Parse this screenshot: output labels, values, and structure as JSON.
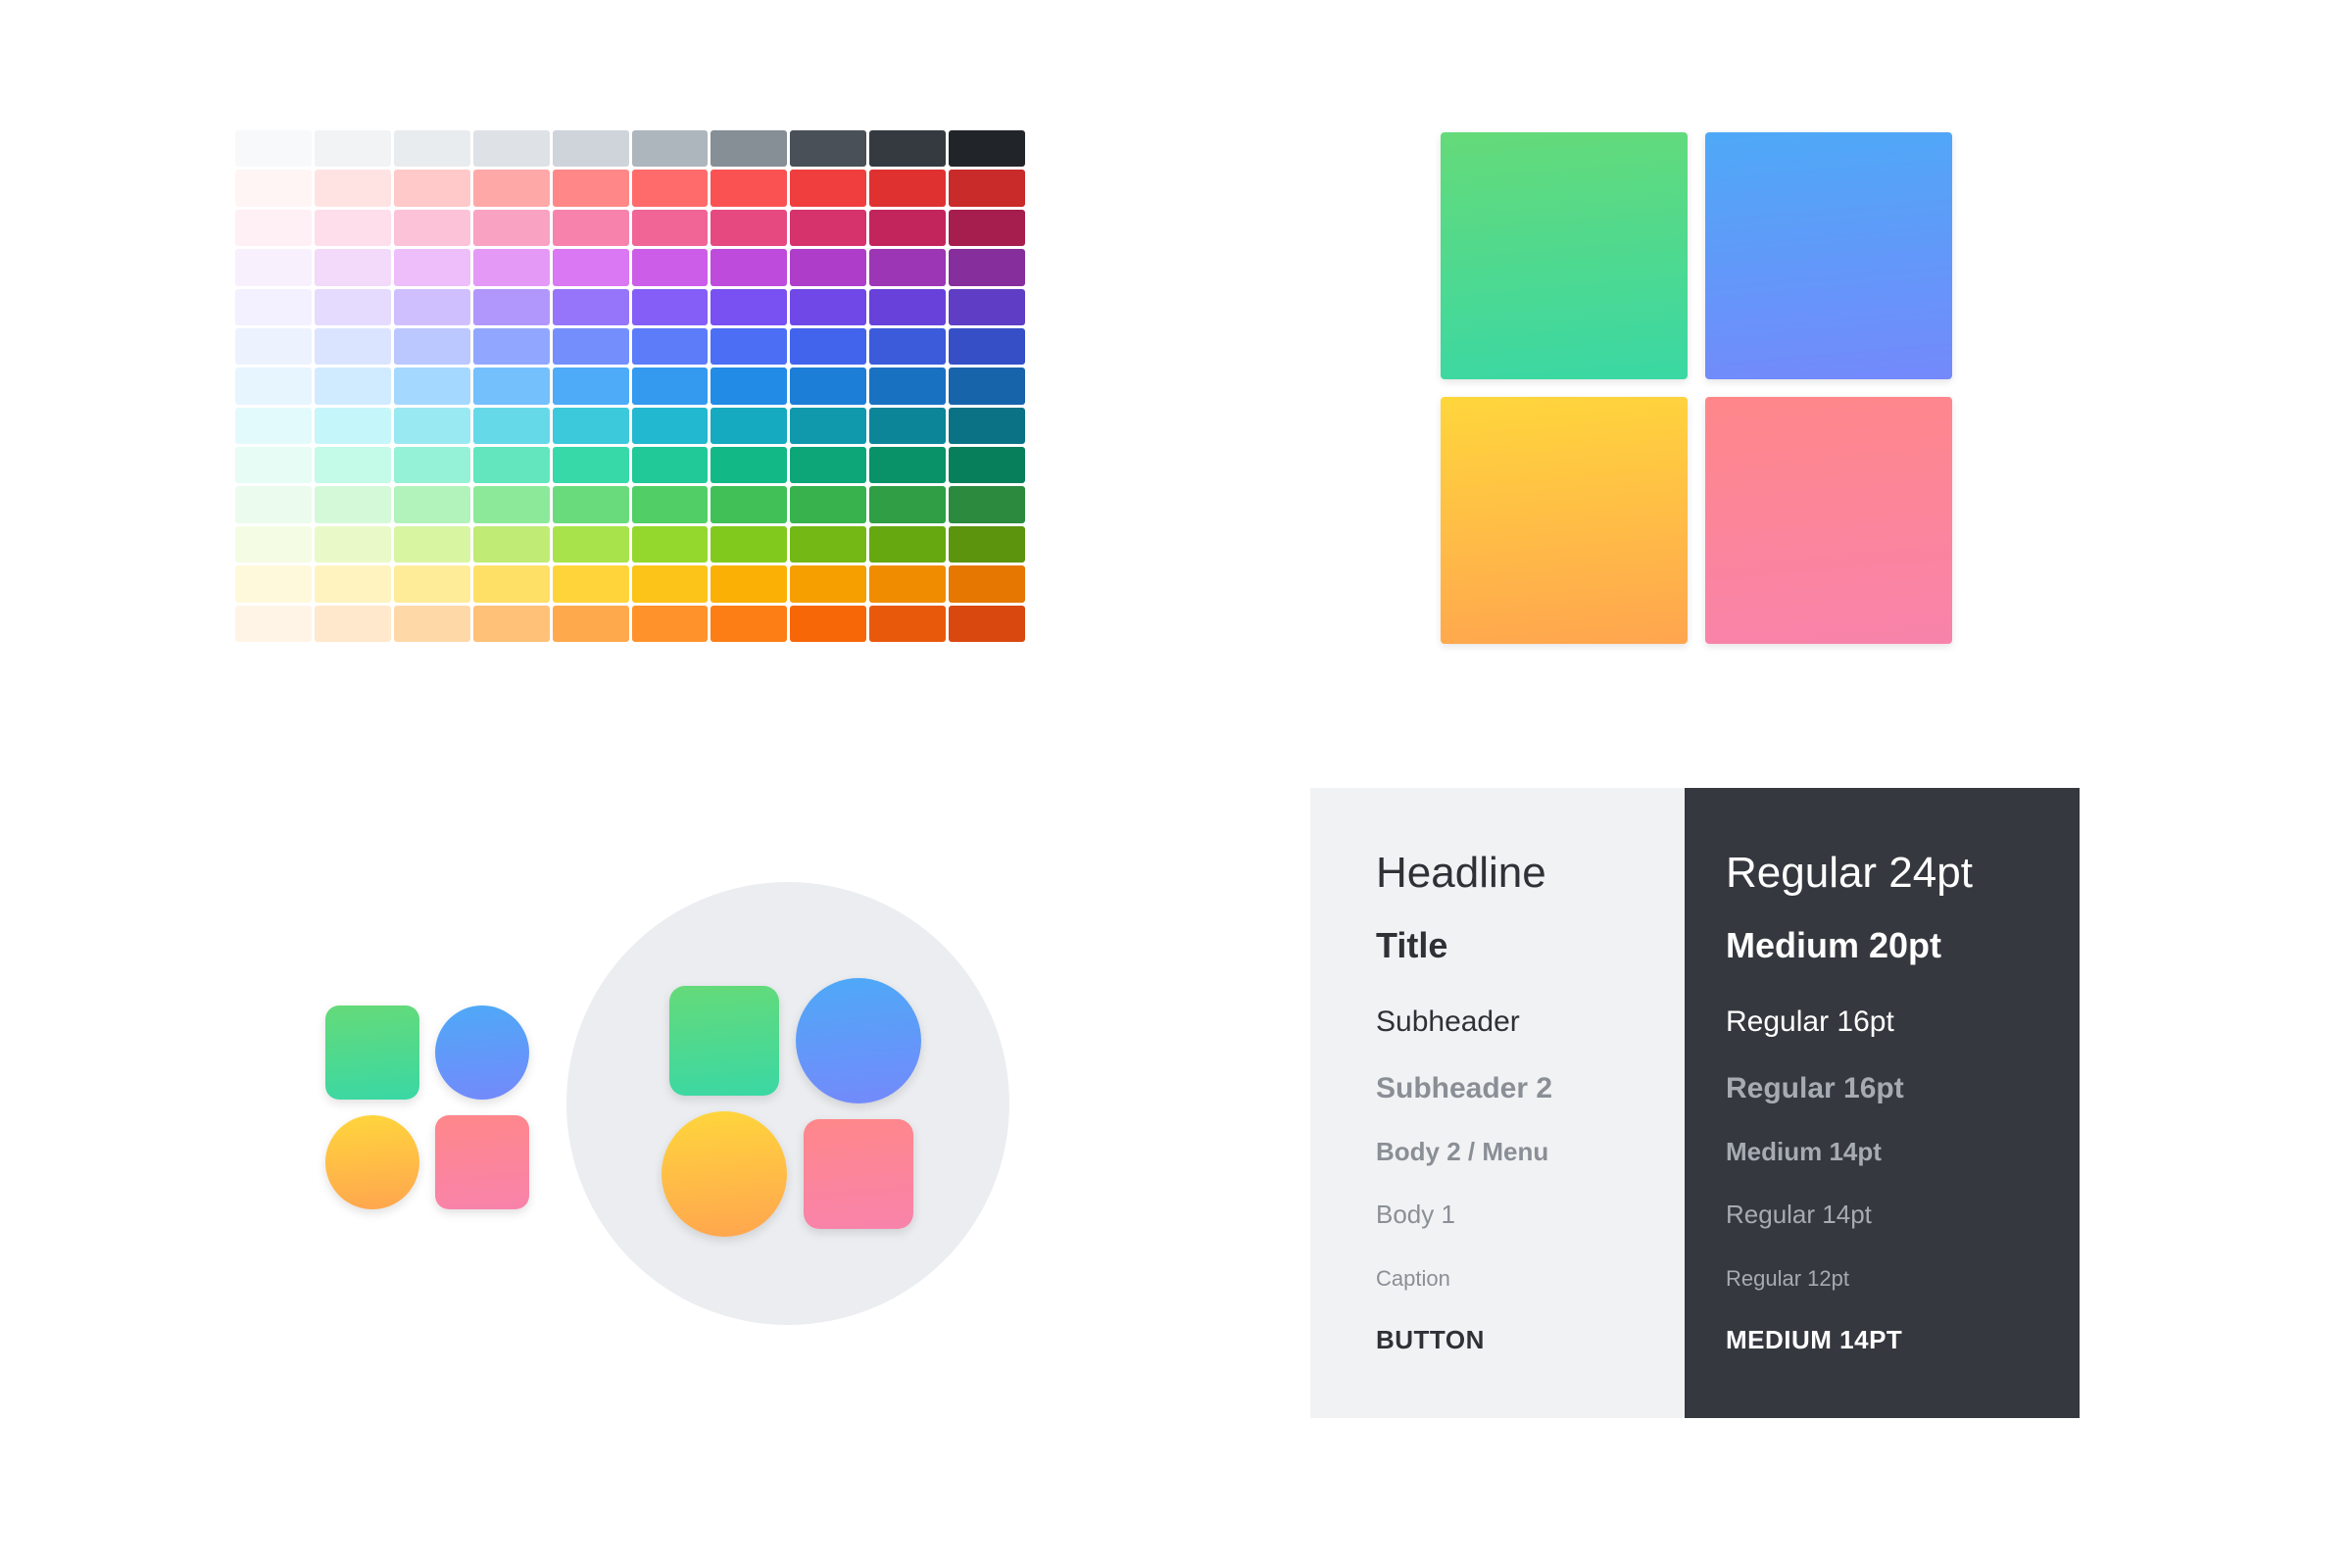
{
  "palette": {
    "rows": [
      [
        "#f8f9fa",
        "#f1f3f5",
        "#e9ecef",
        "#dee2e6",
        "#ced4da",
        "#adb5bd",
        "#868e96",
        "#495057",
        "#343a40",
        "#212529"
      ],
      [
        "#fff5f5",
        "#ffe3e3",
        "#ffc9c9",
        "#ffa8a8",
        "#ff8787",
        "#ff6b6b",
        "#fa5252",
        "#f03e3e",
        "#e03131",
        "#c92a2a"
      ],
      [
        "#fff0f6",
        "#ffdeeb",
        "#fcc2d7",
        "#faa2c1",
        "#f783ac",
        "#f06595",
        "#e64980",
        "#d6336c",
        "#c2255c",
        "#a61e4d"
      ],
      [
        "#f8f0fc",
        "#f3d9fa",
        "#eebefa",
        "#e599f7",
        "#da77f2",
        "#cc5de8",
        "#be4bdb",
        "#ae3ec9",
        "#9c36b5",
        "#862e9c"
      ],
      [
        "#f3f0ff",
        "#e5dbff",
        "#d0bfff",
        "#b197fc",
        "#9775fa",
        "#845ef7",
        "#7950f2",
        "#7048e8",
        "#6741d9",
        "#5f3dc4"
      ],
      [
        "#edf2ff",
        "#dbe4ff",
        "#bac8ff",
        "#91a7ff",
        "#748ffc",
        "#5c7cfa",
        "#4c6ef5",
        "#4263eb",
        "#3b5bdb",
        "#364fc7"
      ],
      [
        "#e7f5ff",
        "#d0ebff",
        "#a5d8ff",
        "#74c0fc",
        "#4dabf7",
        "#339af0",
        "#228be6",
        "#1c7ed6",
        "#1971c2",
        "#1864ab"
      ],
      [
        "#e3fafc",
        "#c5f6fa",
        "#99e9f2",
        "#66d9e8",
        "#3bc9db",
        "#22b8cf",
        "#15aabf",
        "#1098ad",
        "#0c8599",
        "#0b7285"
      ],
      [
        "#e6fcf5",
        "#c3fae8",
        "#96f2d7",
        "#63e6be",
        "#38d9a9",
        "#20c997",
        "#12b886",
        "#0ca678",
        "#099268",
        "#087f5b"
      ],
      [
        "#ebfbee",
        "#d3f9d8",
        "#b2f2bb",
        "#8ce99a",
        "#69db7c",
        "#51cf66",
        "#40c057",
        "#37b24d",
        "#2f9e44",
        "#2b8a3e"
      ],
      [
        "#f4fce3",
        "#e9fac8",
        "#d8f5a2",
        "#c0eb75",
        "#a9e34b",
        "#94d82d",
        "#82c91e",
        "#74b816",
        "#66a80f",
        "#5c940d"
      ],
      [
        "#fff9db",
        "#fff3bf",
        "#ffec99",
        "#ffe066",
        "#ffd43b",
        "#fcc419",
        "#fab005",
        "#f59f00",
        "#f08c00",
        "#e67700"
      ],
      [
        "#fff4e6",
        "#ffe8cc",
        "#ffd8a8",
        "#ffc078",
        "#ffa94d",
        "#ff922b",
        "#fd7e14",
        "#f76707",
        "#e8590c",
        "#d9480f"
      ]
    ]
  },
  "gradients": {
    "green": [
      "#65da79",
      "#3ad8a4"
    ],
    "blue": [
      "#4ea9f7",
      "#7489fb"
    ],
    "yellow": [
      "#ffd63c",
      "#ffa54f"
    ],
    "pink": [
      "#ff878a",
      "#f883ab"
    ]
  },
  "typography": {
    "styles": [
      {
        "name": "Headline",
        "spec": "Regular 24pt"
      },
      {
        "name": "Title",
        "spec": "Medium 20pt"
      },
      {
        "name": "Subheader",
        "spec": "Regular 16pt"
      },
      {
        "name": "Subheader 2",
        "spec": "Regular 16pt"
      },
      {
        "name": "Body 2 / Menu",
        "spec": "Medium 14pt"
      },
      {
        "name": "Body 1",
        "spec": "Regular 14pt"
      },
      {
        "name": "Caption",
        "spec": "Regular 12pt"
      },
      {
        "name": "BUTTON",
        "spec": "MEDIUM 14PT"
      }
    ]
  },
  "colors": {
    "panel_light": "#f1f2f4",
    "panel_dark": "#35383e",
    "circle_bg": "#ebedf0"
  }
}
